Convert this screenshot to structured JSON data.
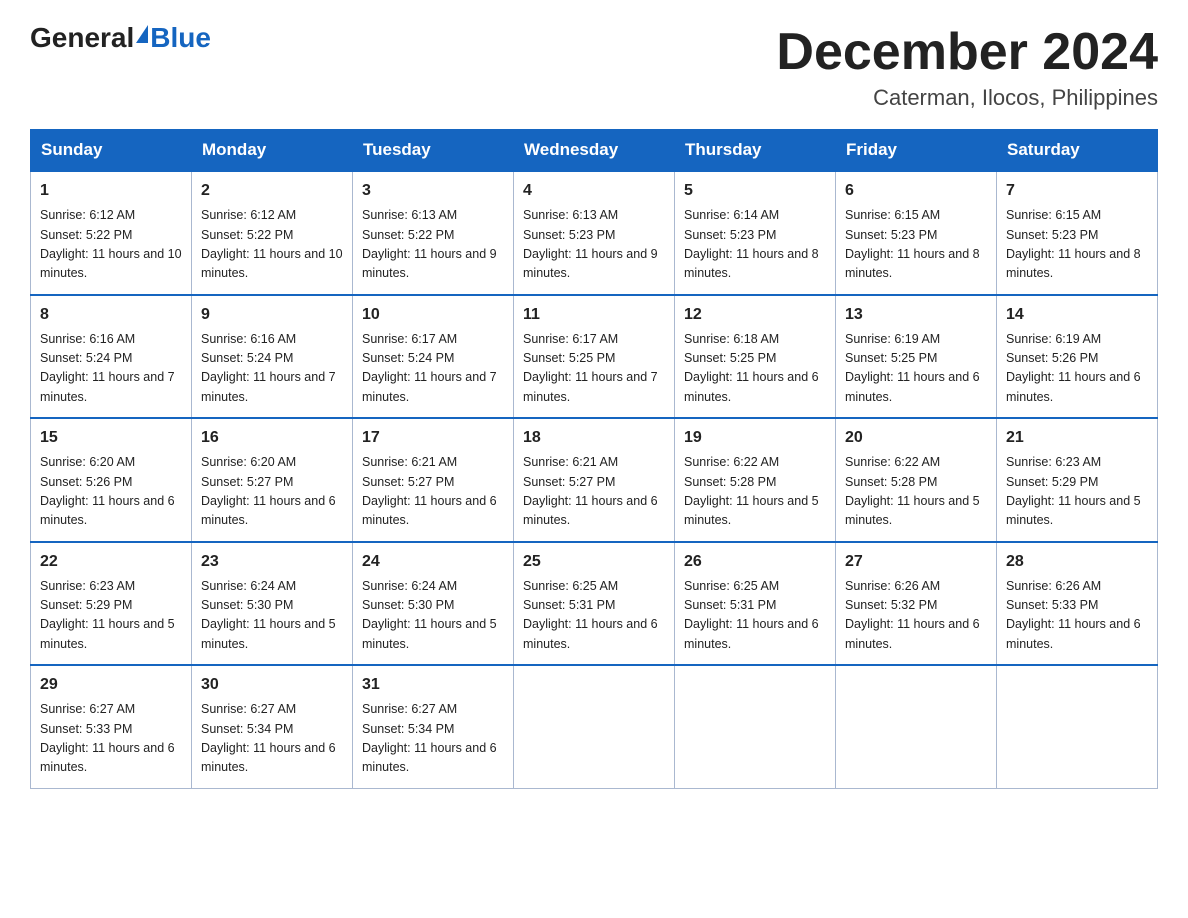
{
  "logo": {
    "general": "General",
    "blue": "Blue"
  },
  "title": {
    "month_year": "December 2024",
    "location": "Caterman, Ilocos, Philippines"
  },
  "days_of_week": [
    "Sunday",
    "Monday",
    "Tuesday",
    "Wednesday",
    "Thursday",
    "Friday",
    "Saturday"
  ],
  "weeks": [
    [
      {
        "day": "1",
        "sunrise": "6:12 AM",
        "sunset": "5:22 PM",
        "daylight": "11 hours and 10 minutes."
      },
      {
        "day": "2",
        "sunrise": "6:12 AM",
        "sunset": "5:22 PM",
        "daylight": "11 hours and 10 minutes."
      },
      {
        "day": "3",
        "sunrise": "6:13 AM",
        "sunset": "5:22 PM",
        "daylight": "11 hours and 9 minutes."
      },
      {
        "day": "4",
        "sunrise": "6:13 AM",
        "sunset": "5:23 PM",
        "daylight": "11 hours and 9 minutes."
      },
      {
        "day": "5",
        "sunrise": "6:14 AM",
        "sunset": "5:23 PM",
        "daylight": "11 hours and 8 minutes."
      },
      {
        "day": "6",
        "sunrise": "6:15 AM",
        "sunset": "5:23 PM",
        "daylight": "11 hours and 8 minutes."
      },
      {
        "day": "7",
        "sunrise": "6:15 AM",
        "sunset": "5:23 PM",
        "daylight": "11 hours and 8 minutes."
      }
    ],
    [
      {
        "day": "8",
        "sunrise": "6:16 AM",
        "sunset": "5:24 PM",
        "daylight": "11 hours and 7 minutes."
      },
      {
        "day": "9",
        "sunrise": "6:16 AM",
        "sunset": "5:24 PM",
        "daylight": "11 hours and 7 minutes."
      },
      {
        "day": "10",
        "sunrise": "6:17 AM",
        "sunset": "5:24 PM",
        "daylight": "11 hours and 7 minutes."
      },
      {
        "day": "11",
        "sunrise": "6:17 AM",
        "sunset": "5:25 PM",
        "daylight": "11 hours and 7 minutes."
      },
      {
        "day": "12",
        "sunrise": "6:18 AM",
        "sunset": "5:25 PM",
        "daylight": "11 hours and 6 minutes."
      },
      {
        "day": "13",
        "sunrise": "6:19 AM",
        "sunset": "5:25 PM",
        "daylight": "11 hours and 6 minutes."
      },
      {
        "day": "14",
        "sunrise": "6:19 AM",
        "sunset": "5:26 PM",
        "daylight": "11 hours and 6 minutes."
      }
    ],
    [
      {
        "day": "15",
        "sunrise": "6:20 AM",
        "sunset": "5:26 PM",
        "daylight": "11 hours and 6 minutes."
      },
      {
        "day": "16",
        "sunrise": "6:20 AM",
        "sunset": "5:27 PM",
        "daylight": "11 hours and 6 minutes."
      },
      {
        "day": "17",
        "sunrise": "6:21 AM",
        "sunset": "5:27 PM",
        "daylight": "11 hours and 6 minutes."
      },
      {
        "day": "18",
        "sunrise": "6:21 AM",
        "sunset": "5:27 PM",
        "daylight": "11 hours and 6 minutes."
      },
      {
        "day": "19",
        "sunrise": "6:22 AM",
        "sunset": "5:28 PM",
        "daylight": "11 hours and 5 minutes."
      },
      {
        "day": "20",
        "sunrise": "6:22 AM",
        "sunset": "5:28 PM",
        "daylight": "11 hours and 5 minutes."
      },
      {
        "day": "21",
        "sunrise": "6:23 AM",
        "sunset": "5:29 PM",
        "daylight": "11 hours and 5 minutes."
      }
    ],
    [
      {
        "day": "22",
        "sunrise": "6:23 AM",
        "sunset": "5:29 PM",
        "daylight": "11 hours and 5 minutes."
      },
      {
        "day": "23",
        "sunrise": "6:24 AM",
        "sunset": "5:30 PM",
        "daylight": "11 hours and 5 minutes."
      },
      {
        "day": "24",
        "sunrise": "6:24 AM",
        "sunset": "5:30 PM",
        "daylight": "11 hours and 5 minutes."
      },
      {
        "day": "25",
        "sunrise": "6:25 AM",
        "sunset": "5:31 PM",
        "daylight": "11 hours and 6 minutes."
      },
      {
        "day": "26",
        "sunrise": "6:25 AM",
        "sunset": "5:31 PM",
        "daylight": "11 hours and 6 minutes."
      },
      {
        "day": "27",
        "sunrise": "6:26 AM",
        "sunset": "5:32 PM",
        "daylight": "11 hours and 6 minutes."
      },
      {
        "day": "28",
        "sunrise": "6:26 AM",
        "sunset": "5:33 PM",
        "daylight": "11 hours and 6 minutes."
      }
    ],
    [
      {
        "day": "29",
        "sunrise": "6:27 AM",
        "sunset": "5:33 PM",
        "daylight": "11 hours and 6 minutes."
      },
      {
        "day": "30",
        "sunrise": "6:27 AM",
        "sunset": "5:34 PM",
        "daylight": "11 hours and 6 minutes."
      },
      {
        "day": "31",
        "sunrise": "6:27 AM",
        "sunset": "5:34 PM",
        "daylight": "11 hours and 6 minutes."
      },
      null,
      null,
      null,
      null
    ]
  ]
}
